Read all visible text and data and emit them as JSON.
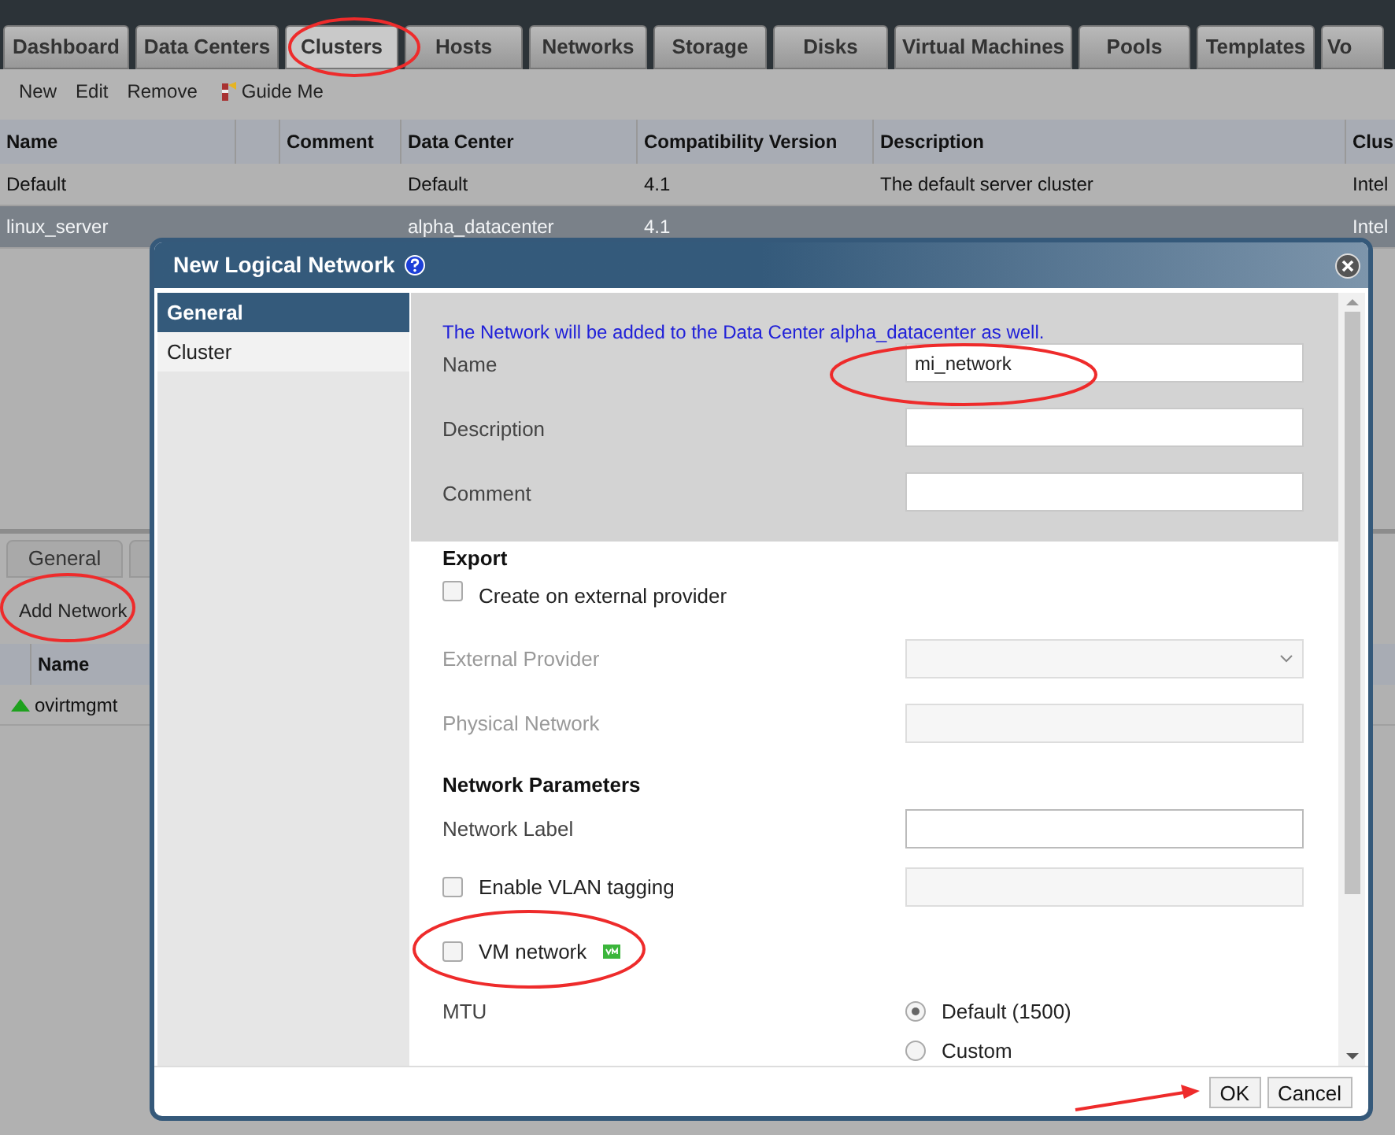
{
  "main_tabs": [
    {
      "label": "Dashboard",
      "selected": false
    },
    {
      "label": "Data Centers",
      "selected": false
    },
    {
      "label": "Clusters",
      "selected": true
    },
    {
      "label": "Hosts",
      "selected": false
    },
    {
      "label": "Networks",
      "selected": false
    },
    {
      "label": "Storage",
      "selected": false
    },
    {
      "label": "Disks",
      "selected": false
    },
    {
      "label": "Virtual Machines",
      "selected": false
    },
    {
      "label": "Pools",
      "selected": false
    },
    {
      "label": "Templates",
      "selected": false
    },
    {
      "label": "Vo",
      "selected": false
    }
  ],
  "toolbar": [
    {
      "label": "New",
      "kind": "plain"
    },
    {
      "label": "Edit",
      "kind": "plain"
    },
    {
      "label": "Remove",
      "kind": "plain"
    },
    {
      "label": "Guide Me",
      "kind": "guide"
    }
  ],
  "clusters_table": {
    "columns": [
      "Name",
      "Comment",
      "Data Center",
      "Compatibility Version",
      "Description",
      "Clus"
    ],
    "rows": [
      {
        "name": "Default",
        "data_center": "Default",
        "compatibility_version": "4.1",
        "description": "The default server cluster",
        "column_6": "Intel",
        "selected": false
      },
      {
        "name": "linux_server",
        "data_center": "alpha_datacenter",
        "compatibility_version": "4.1",
        "column_6": "Intel",
        "selected": true
      }
    ]
  },
  "detail_panel": {
    "tabs": [
      {
        "label": "General",
        "selected": true
      }
    ],
    "add_button": "Add Network",
    "columns": [
      "Name"
    ],
    "rows": [
      {
        "name": "ovirtmgmt",
        "up": true
      }
    ]
  },
  "dialog": {
    "title": "New Logical Network",
    "nav": [
      {
        "label": "General",
        "selected": true
      },
      {
        "label": "Cluster",
        "selected": false
      }
    ],
    "info": "The Network will be added to the Data Center alpha_datacenter as well.",
    "top_fields": [
      {
        "label": "Name",
        "value": "mi_network"
      },
      {
        "label": "Description"
      },
      {
        "label": "Comment"
      }
    ],
    "items": [
      {
        "kind": "heading",
        "text": "Export"
      },
      {
        "kind": "checkbox",
        "label": "Create on external provider",
        "checked": false
      },
      {
        "kind": "select",
        "label": "External Provider",
        "disabled": true
      },
      {
        "kind": "field",
        "label": "Physical Network",
        "disabled": true
      },
      {
        "kind": "heading",
        "text": "Network Parameters"
      },
      {
        "kind": "field",
        "label": "Network Label",
        "disabled": false
      },
      {
        "kind": "checkbox_field",
        "label": "Enable VLAN tagging",
        "checked": false,
        "disabled": true
      },
      {
        "kind": "checkbox",
        "label": "VM network",
        "checked": false,
        "vm_icon": true
      },
      {
        "kind": "radio_group",
        "label": "MTU",
        "options": [
          {
            "label": "Default (1500)",
            "selected": true
          },
          {
            "label": "Custom",
            "selected": false
          }
        ]
      }
    ],
    "buttons": [
      "OK",
      "Cancel"
    ]
  }
}
